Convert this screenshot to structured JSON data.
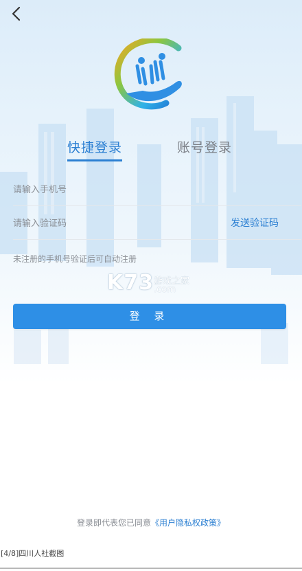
{
  "nav": {
    "back_icon": "chevron-left-icon"
  },
  "logo": {
    "icon": "app-logo-hand-people"
  },
  "tabs": [
    {
      "label": "快捷登录",
      "active": true
    },
    {
      "label": "账号登录",
      "active": false
    }
  ],
  "form": {
    "phone_placeholder": "请输入手机号",
    "code_placeholder": "请输入验证码",
    "send_code_label": "发送验证码",
    "hint": "未注册的手机号验证后可自动注册",
    "login_label": "登 录"
  },
  "watermark": {
    "main": "K73",
    "line1": "游戏之家",
    "line2": ".com"
  },
  "agreement": {
    "prefix": "登录即代表您已同意",
    "link": "《用户隐私权政策》"
  },
  "caption": "[4/8]四川人社截图",
  "colors": {
    "accent": "#2b7fd2",
    "button": "#2e8fe6",
    "hint": "#8a8e94"
  }
}
